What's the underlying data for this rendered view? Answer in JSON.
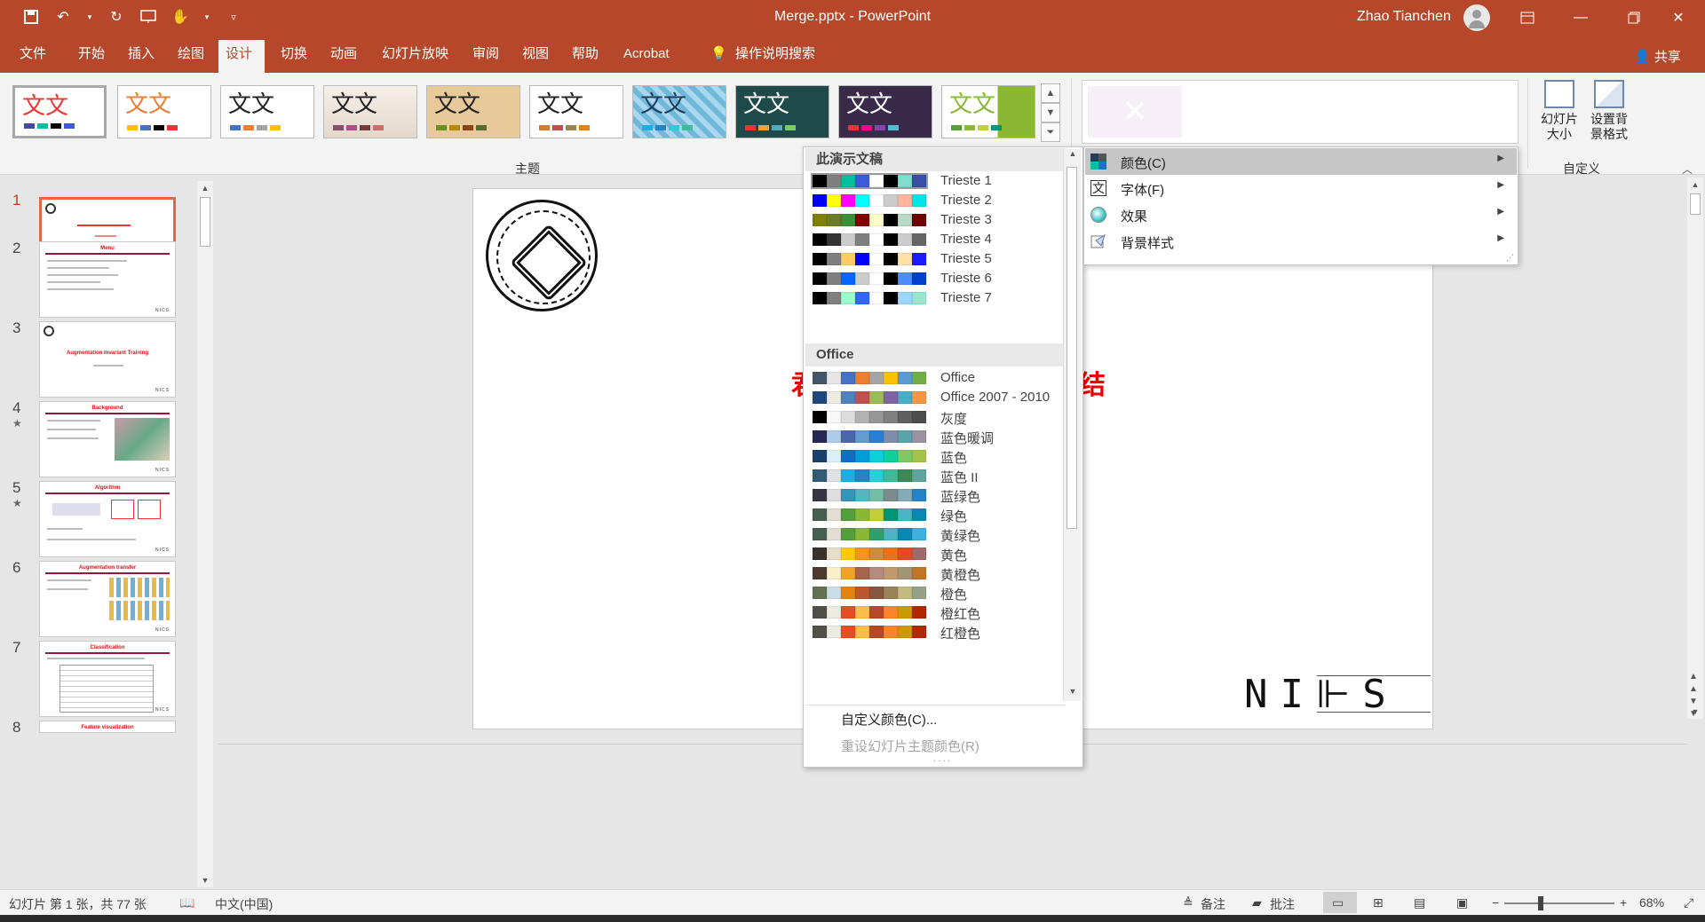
{
  "titlebar": {
    "doc_title": "Merge.pptx  -  PowerPoint",
    "user": "Zhao Tianchen"
  },
  "tabs": [
    "文件",
    "开始",
    "插入",
    "绘图",
    "设计",
    "切换",
    "动画",
    "幻灯片放映",
    "审阅",
    "视图",
    "帮助",
    "Acrobat",
    "操作说明搜索"
  ],
  "share_label": "共享",
  "ribbon": {
    "theme_char": "文文",
    "themes_label": "主题",
    "custom_label": "自定义",
    "slide_size_label": "幻灯片\n大小",
    "format_bg_label": "设置背\n景格式"
  },
  "slides": {
    "numbers": [
      "1",
      "2",
      "3",
      "4",
      "5",
      "6",
      "7",
      "8"
    ],
    "thumb_titles": [
      "",
      "Menu",
      "Augmentation Invariant Training",
      "Background",
      "Algorithm",
      "Augmentation transfer",
      "Classification",
      "Feature visualization"
    ],
    "nics": "NICS",
    "star": "★"
  },
  "slide": {
    "title_frag_left": "君",
    "title_frag_right": "结",
    "logo_text": "NI⊩S"
  },
  "colors_menu": {
    "group1": "此演示文稿",
    "group2": "Office",
    "this_presentation": [
      {
        "name": "Trieste 1",
        "colors": [
          "#000000",
          "#7f7f7f",
          "#00c09f",
          "#3b5bdb",
          "#ffffff",
          "#000000",
          "#7ee0cc",
          "#3a4ea8"
        ]
      },
      {
        "name": "Trieste 2",
        "colors": [
          "#0000ff",
          "#ffff00",
          "#ff00ff",
          "#00ffff",
          "#ffffff",
          "#cccccc",
          "#ffb59c",
          "#00e5e5"
        ]
      },
      {
        "name": "Trieste 3",
        "colors": [
          "#7f7f00",
          "#6b7b2a",
          "#3a8f3a",
          "#800000",
          "#ffffcc",
          "#000000",
          "#b8d8c8",
          "#6e0000"
        ]
      },
      {
        "name": "Trieste 4",
        "colors": [
          "#000000",
          "#333333",
          "#cccccc",
          "#7f7f7f",
          "#ffffff",
          "#000000",
          "#cccccc",
          "#666666"
        ]
      },
      {
        "name": "Trieste 5",
        "colors": [
          "#000000",
          "#7f7f7f",
          "#ffcc66",
          "#0000ff",
          "#ffffff",
          "#000000",
          "#ffe0a8",
          "#1a1aff"
        ]
      },
      {
        "name": "Trieste 6",
        "colors": [
          "#000000",
          "#7f7f7f",
          "#0066ff",
          "#cccccc",
          "#ffffff",
          "#000000",
          "#4d8cff",
          "#0040cc"
        ]
      },
      {
        "name": "Trieste 7",
        "colors": [
          "#000000",
          "#7f7f7f",
          "#99ffcc",
          "#3366ff",
          "#ffffff",
          "#000000",
          "#9ad6ff",
          "#99e6cc"
        ]
      }
    ],
    "office": [
      {
        "name": "Office",
        "colors": [
          "#44546a",
          "#e7e6e6",
          "#4472c4",
          "#ed7d31",
          "#a5a5a5",
          "#ffc000",
          "#5b9bd5",
          "#70ad47"
        ]
      },
      {
        "name": "Office 2007 - 2010",
        "colors": [
          "#1f497d",
          "#eeece1",
          "#4f81bd",
          "#c0504d",
          "#9bbb59",
          "#8064a2",
          "#4bacc6",
          "#f79646"
        ]
      },
      {
        "name": "灰度",
        "colors": [
          "#000000",
          "#f8f8f8",
          "#dddddd",
          "#b2b2b2",
          "#969696",
          "#808080",
          "#5f5f5f",
          "#4d4d4d"
        ]
      },
      {
        "name": "蓝色暖调",
        "colors": [
          "#242852",
          "#acccea",
          "#4a66ac",
          "#629dd1",
          "#297fd5",
          "#7f8fa9",
          "#5aa2ae",
          "#9d90a0"
        ]
      },
      {
        "name": "蓝色",
        "colors": [
          "#17406d",
          "#dbeff9",
          "#0f6fc6",
          "#009dd9",
          "#0bd0d9",
          "#10cf9b",
          "#7cca62",
          "#a5c249"
        ]
      },
      {
        "name": "蓝色 II",
        "colors": [
          "#335b74",
          "#dfe3e5",
          "#1cade4",
          "#2683c6",
          "#27ced7",
          "#42ba97",
          "#3e8853",
          "#62a39f"
        ]
      },
      {
        "name": "蓝绿色",
        "colors": [
          "#373545",
          "#dedede",
          "#3494ba",
          "#58b6c0",
          "#75bda7",
          "#7a8c8e",
          "#84acb6",
          "#2683c6"
        ]
      },
      {
        "name": "绿色",
        "colors": [
          "#455f51",
          "#e3ded1",
          "#549e39",
          "#8ab833",
          "#c0cf3a",
          "#029676",
          "#4ab5c4",
          "#0989b1"
        ]
      },
      {
        "name": "黄绿色",
        "colors": [
          "#455f51",
          "#e3ded1",
          "#549e39",
          "#8ab833",
          "#2ba26e",
          "#4ab5c4",
          "#0989b1",
          "#3fb0e0"
        ]
      },
      {
        "name": "黄色",
        "colors": [
          "#39302a",
          "#e5dec9",
          "#ffca08",
          "#f8931d",
          "#ce8d3e",
          "#ec7016",
          "#e64823",
          "#9c6a6a"
        ]
      },
      {
        "name": "黄橙色",
        "colors": [
          "#4e3b30",
          "#fbeec9",
          "#f0a22e",
          "#a5644e",
          "#b58b80",
          "#c3986d",
          "#a19574",
          "#c17529"
        ]
      },
      {
        "name": "橙色",
        "colors": [
          "#637052",
          "#ccddea",
          "#e48312",
          "#bd582c",
          "#865640",
          "#9b8357",
          "#c2bc80",
          "#94a088"
        ]
      },
      {
        "name": "橙红色",
        "colors": [
          "#505046",
          "#eeece1",
          "#e84c22",
          "#ffbd47",
          "#b64926",
          "#ff8427",
          "#cc9900",
          "#b22600"
        ]
      },
      {
        "name": "红橙色",
        "colors": [
          "#505046",
          "#eeece1",
          "#e84c22",
          "#ffbd47",
          "#b64926",
          "#ff8427",
          "#cc9900",
          "#b22600"
        ]
      }
    ],
    "custom_colors": "自定义颜色(C)...",
    "reset_colors": "重设幻灯片主题颜色(R)"
  },
  "variants_menu": {
    "items": [
      "颜色(C)",
      "字体(F)",
      "效果",
      "背景样式"
    ]
  },
  "statusbar": {
    "slide_info": "幻灯片 第 1 张，共 77 张",
    "language": "中文(中国)",
    "notes": "备注",
    "comments": "批注",
    "zoom": "68%"
  }
}
